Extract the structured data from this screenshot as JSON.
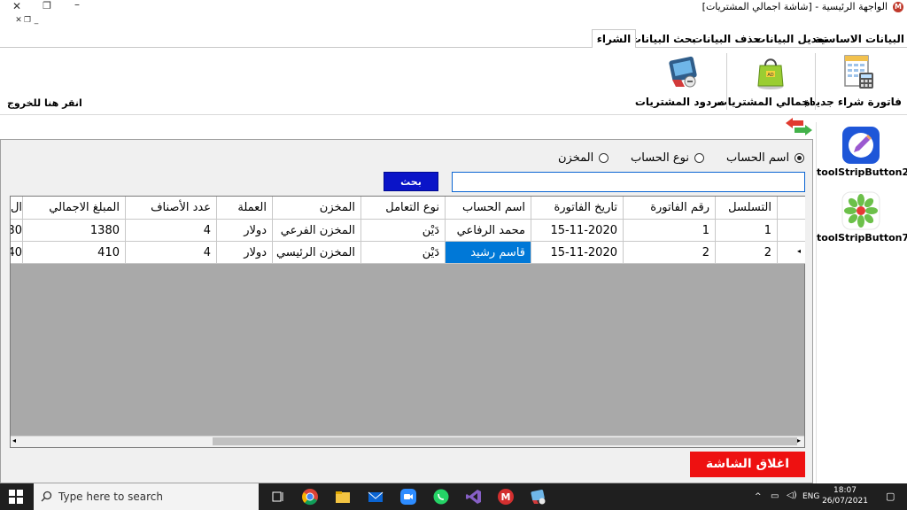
{
  "window": {
    "title": "الواجهة الرئيسية - [شاشة اجمالي المشتريات]",
    "app_icon_letter": "M"
  },
  "ribbon": {
    "tabs": [
      "البيانات الاساسية",
      "تعديل البيانات",
      "حذف البيانات",
      "بحث البيانات",
      "الشراء"
    ],
    "active_tab": "الشراء",
    "buttons": [
      {
        "label": "فاتورة شراء جديدة",
        "icon": "calculator-invoice-icon"
      },
      {
        "label": "اجمالي المشتريات",
        "icon": "shopping-bag-icon"
      },
      {
        "label": "مردود المشتريات",
        "icon": "return-cart-icon"
      }
    ],
    "exit_label": "انقر هنا للخروج"
  },
  "toolstrip": {
    "buttons": [
      {
        "label": "toolStripButton2",
        "icon": "pencil-edit-icon"
      },
      {
        "label": "toolStripButton7",
        "icon": "flower-settings-icon"
      }
    ]
  },
  "filters": {
    "options": [
      "اسم الحساب",
      "نوع الحساب",
      "المخزن"
    ],
    "selected": "اسم الحساب",
    "search_button": "بحث",
    "search_value": ""
  },
  "grid": {
    "columns": [
      "التسلسل",
      "رقم الفاتورة",
      "تاريخ الفاتورة",
      "اسم الحساب",
      "نوع التعامل",
      "المخزن",
      "العملة",
      "عدد الأصناف",
      "المبلغ الاجمالي",
      "ال"
    ],
    "rows": [
      [
        "1",
        "1",
        "15-11-2020",
        "محمد الرفاعي",
        "دَيْن",
        "المخزن الفرعي",
        "دولار",
        "4",
        "1380",
        "30"
      ],
      [
        "2",
        "2",
        "15-11-2020",
        "قاسم رشيد",
        "دَيْن",
        "المخزن الرئيسي",
        "دولار",
        "4",
        "410",
        "40"
      ]
    ],
    "selected_cell": {
      "row": 1,
      "column": "اسم الحساب"
    }
  },
  "close_button": "اغلاق الشاشة",
  "taskbar": {
    "search_placeholder": "Type here to search",
    "language": "ENG",
    "time": "18:07",
    "date": "26/07/2021"
  },
  "colors": {
    "search_button": "#0a14c8",
    "close_button": "#ee1111",
    "selection": "#0078d7",
    "grid_background": "#a9a9a9"
  }
}
